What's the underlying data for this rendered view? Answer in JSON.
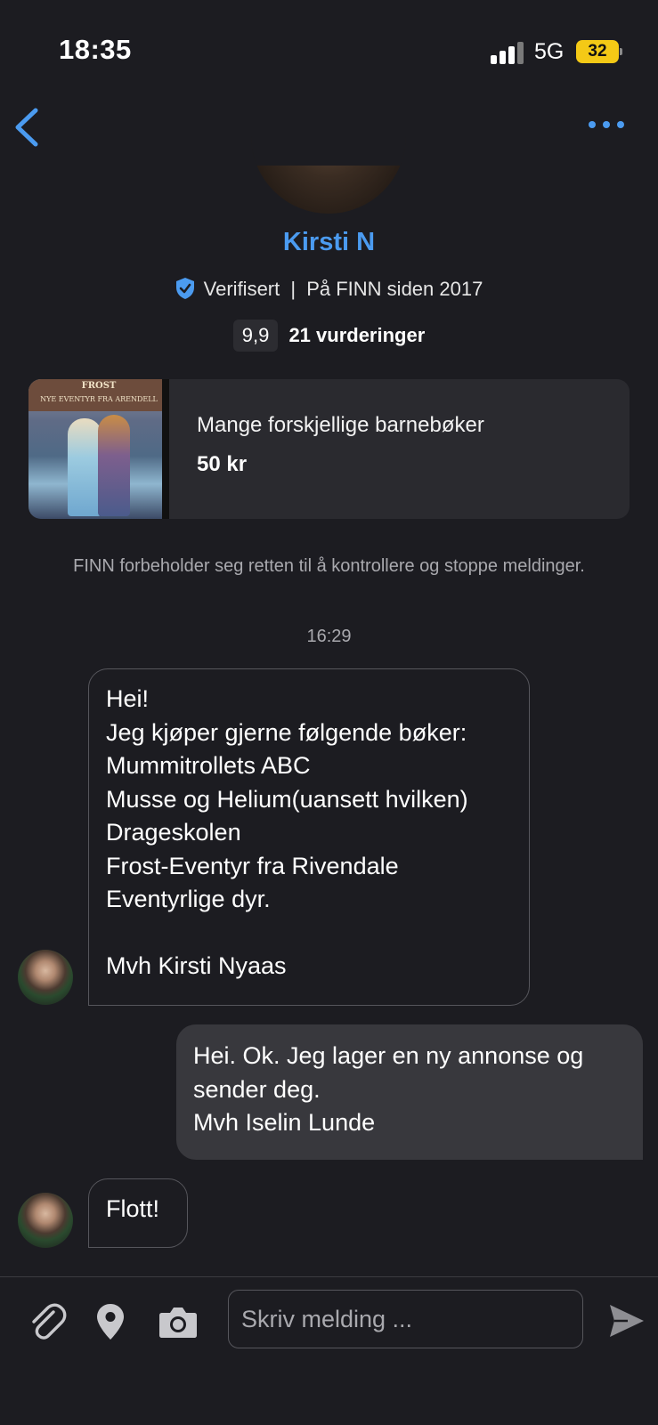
{
  "status_bar": {
    "time": "18:35",
    "network": "5G",
    "battery": "32"
  },
  "profile": {
    "name": "Kirsti N",
    "verified_label": "Verifisert",
    "separator": "|",
    "member_since": "På FINN siden 2017",
    "rating_score": "9,9",
    "rating_count": "21 vurderinger"
  },
  "ad": {
    "thumbnail_title": "FROST",
    "thumbnail_subtitle": "NYE EVENTYR FRA ARENDELL",
    "title": "Mange forskjellige barnebøker",
    "price": "50 kr"
  },
  "disclaimer": "FINN forbeholder seg retten til å kontrollere og stoppe meldinger.",
  "timestamp": "16:29",
  "messages": [
    {
      "from": "other",
      "text": "Hei!\nJeg kjøper gjerne følgende bøker:\nMummitrollets ABC\nMusse og Helium(uansett hvilken)\nDrageskolen\nFrost-Eventyr fra Rivendale\nEventyrlige dyr.\n\nMvh Kirsti Nyaas"
    },
    {
      "from": "me",
      "text": "Hei. Ok. Jeg lager en ny annonse og\nsender deg.\nMvh Iselin Lunde"
    },
    {
      "from": "other",
      "text": "Flott!"
    }
  ],
  "composer": {
    "placeholder": "Skriv melding ..."
  },
  "colors": {
    "background": "#1c1c21",
    "accent": "#4b9bf0",
    "outgoing_bubble": "#38383d",
    "battery": "#f4c916"
  },
  "icons": [
    "back-chevron-icon",
    "more-dots-icon",
    "verified-shield-icon",
    "paperclip-icon",
    "location-pin-icon",
    "camera-icon",
    "send-icon"
  ]
}
